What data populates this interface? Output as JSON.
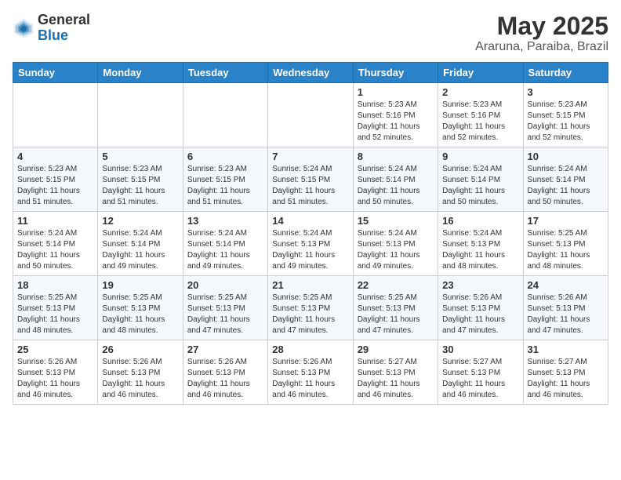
{
  "logo": {
    "general": "General",
    "blue": "Blue"
  },
  "header": {
    "month_year": "May 2025",
    "location": "Araruna, Paraiba, Brazil"
  },
  "weekdays": [
    "Sunday",
    "Monday",
    "Tuesday",
    "Wednesday",
    "Thursday",
    "Friday",
    "Saturday"
  ],
  "weeks": [
    [
      {
        "day": "",
        "info": ""
      },
      {
        "day": "",
        "info": ""
      },
      {
        "day": "",
        "info": ""
      },
      {
        "day": "",
        "info": ""
      },
      {
        "day": "1",
        "info": "Sunrise: 5:23 AM\nSunset: 5:16 PM\nDaylight: 11 hours\nand 52 minutes."
      },
      {
        "day": "2",
        "info": "Sunrise: 5:23 AM\nSunset: 5:16 PM\nDaylight: 11 hours\nand 52 minutes."
      },
      {
        "day": "3",
        "info": "Sunrise: 5:23 AM\nSunset: 5:15 PM\nDaylight: 11 hours\nand 52 minutes."
      }
    ],
    [
      {
        "day": "4",
        "info": "Sunrise: 5:23 AM\nSunset: 5:15 PM\nDaylight: 11 hours\nand 51 minutes."
      },
      {
        "day": "5",
        "info": "Sunrise: 5:23 AM\nSunset: 5:15 PM\nDaylight: 11 hours\nand 51 minutes."
      },
      {
        "day": "6",
        "info": "Sunrise: 5:23 AM\nSunset: 5:15 PM\nDaylight: 11 hours\nand 51 minutes."
      },
      {
        "day": "7",
        "info": "Sunrise: 5:24 AM\nSunset: 5:15 PM\nDaylight: 11 hours\nand 51 minutes."
      },
      {
        "day": "8",
        "info": "Sunrise: 5:24 AM\nSunset: 5:14 PM\nDaylight: 11 hours\nand 50 minutes."
      },
      {
        "day": "9",
        "info": "Sunrise: 5:24 AM\nSunset: 5:14 PM\nDaylight: 11 hours\nand 50 minutes."
      },
      {
        "day": "10",
        "info": "Sunrise: 5:24 AM\nSunset: 5:14 PM\nDaylight: 11 hours\nand 50 minutes."
      }
    ],
    [
      {
        "day": "11",
        "info": "Sunrise: 5:24 AM\nSunset: 5:14 PM\nDaylight: 11 hours\nand 50 minutes."
      },
      {
        "day": "12",
        "info": "Sunrise: 5:24 AM\nSunset: 5:14 PM\nDaylight: 11 hours\nand 49 minutes."
      },
      {
        "day": "13",
        "info": "Sunrise: 5:24 AM\nSunset: 5:14 PM\nDaylight: 11 hours\nand 49 minutes."
      },
      {
        "day": "14",
        "info": "Sunrise: 5:24 AM\nSunset: 5:13 PM\nDaylight: 11 hours\nand 49 minutes."
      },
      {
        "day": "15",
        "info": "Sunrise: 5:24 AM\nSunset: 5:13 PM\nDaylight: 11 hours\nand 49 minutes."
      },
      {
        "day": "16",
        "info": "Sunrise: 5:24 AM\nSunset: 5:13 PM\nDaylight: 11 hours\nand 48 minutes."
      },
      {
        "day": "17",
        "info": "Sunrise: 5:25 AM\nSunset: 5:13 PM\nDaylight: 11 hours\nand 48 minutes."
      }
    ],
    [
      {
        "day": "18",
        "info": "Sunrise: 5:25 AM\nSunset: 5:13 PM\nDaylight: 11 hours\nand 48 minutes."
      },
      {
        "day": "19",
        "info": "Sunrise: 5:25 AM\nSunset: 5:13 PM\nDaylight: 11 hours\nand 48 minutes."
      },
      {
        "day": "20",
        "info": "Sunrise: 5:25 AM\nSunset: 5:13 PM\nDaylight: 11 hours\nand 47 minutes."
      },
      {
        "day": "21",
        "info": "Sunrise: 5:25 AM\nSunset: 5:13 PM\nDaylight: 11 hours\nand 47 minutes."
      },
      {
        "day": "22",
        "info": "Sunrise: 5:25 AM\nSunset: 5:13 PM\nDaylight: 11 hours\nand 47 minutes."
      },
      {
        "day": "23",
        "info": "Sunrise: 5:26 AM\nSunset: 5:13 PM\nDaylight: 11 hours\nand 47 minutes."
      },
      {
        "day": "24",
        "info": "Sunrise: 5:26 AM\nSunset: 5:13 PM\nDaylight: 11 hours\nand 47 minutes."
      }
    ],
    [
      {
        "day": "25",
        "info": "Sunrise: 5:26 AM\nSunset: 5:13 PM\nDaylight: 11 hours\nand 46 minutes."
      },
      {
        "day": "26",
        "info": "Sunrise: 5:26 AM\nSunset: 5:13 PM\nDaylight: 11 hours\nand 46 minutes."
      },
      {
        "day": "27",
        "info": "Sunrise: 5:26 AM\nSunset: 5:13 PM\nDaylight: 11 hours\nand 46 minutes."
      },
      {
        "day": "28",
        "info": "Sunrise: 5:26 AM\nSunset: 5:13 PM\nDaylight: 11 hours\nand 46 minutes."
      },
      {
        "day": "29",
        "info": "Sunrise: 5:27 AM\nSunset: 5:13 PM\nDaylight: 11 hours\nand 46 minutes."
      },
      {
        "day": "30",
        "info": "Sunrise: 5:27 AM\nSunset: 5:13 PM\nDaylight: 11 hours\nand 46 minutes."
      },
      {
        "day": "31",
        "info": "Sunrise: 5:27 AM\nSunset: 5:13 PM\nDaylight: 11 hours\nand 46 minutes."
      }
    ]
  ]
}
